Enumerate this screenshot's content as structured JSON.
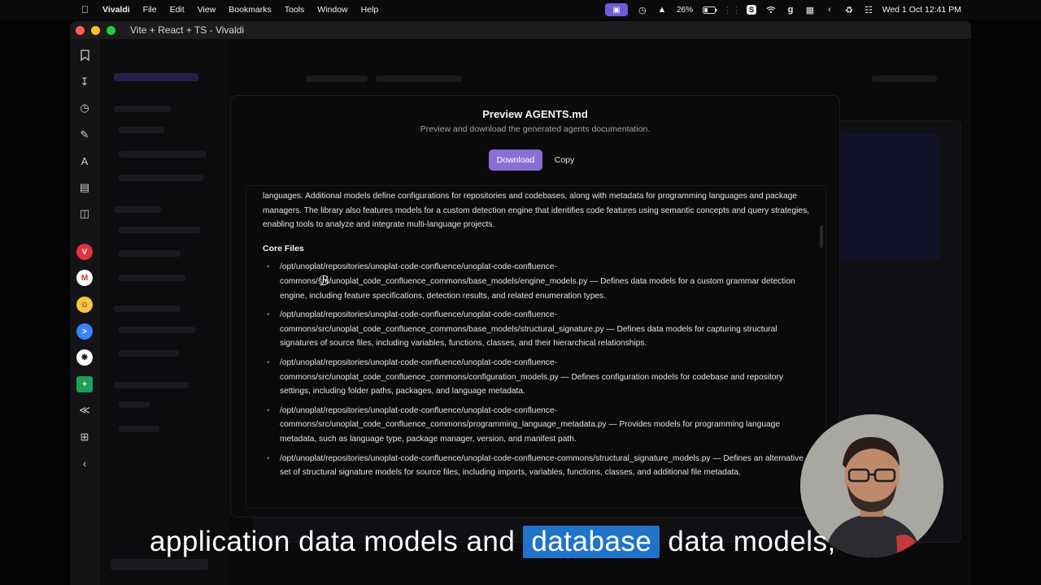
{
  "menubar": {
    "app": "Vivaldi",
    "menus": [
      "File",
      "Edit",
      "View",
      "Bookmarks",
      "Tools",
      "Window",
      "Help"
    ],
    "battery": "26%",
    "clock": "Wed 1 Oct  12:41 PM"
  },
  "window": {
    "title": "Vite + React + TS - Vivaldi"
  },
  "modal": {
    "title": "Preview AGENTS.md",
    "subtitle": "Preview and download the generated agents documentation.",
    "download_label": "Download",
    "copy_label": "Copy",
    "intro": "languages. Additional models define configurations for repositories and codebases, along with metadata for programming languages and package managers. The library also features models for a custom detection engine that identifies code features using semantic concepts and query strategies, enabling tools to analyze and integrate multi-language projects.",
    "section_heading": "Core Files",
    "files": [
      "/opt/unoplat/repositories/unoplat-code-confluence/unoplat-code-confluence-commons/src/unoplat_code_confluence_commons/base_models/engine_models.py — Defines data models for a custom grammar detection engine, including feature specifications, detection results, and related enumeration types.",
      "/opt/unoplat/repositories/unoplat-code-confluence/unoplat-code-confluence-commons/src/unoplat_code_confluence_commons/base_models/structural_signature.py — Defines data models for capturing structural signatures of source files, including variables, functions, classes, and their hierarchical relationships.",
      "/opt/unoplat/repositories/unoplat-code-confluence/unoplat-code-confluence-commons/src/unoplat_code_confluence_commons/configuration_models.py — Defines configuration models for codebase and repository settings, including folder paths, packages, and language metadata.",
      "/opt/unoplat/repositories/unoplat-code-confluence/unoplat-code-confluence-commons/src/unoplat_code_confluence_commons/programming_language_metadata.py — Provides models for programming language metadata, such as language type, package manager, version, and manifest path.",
      "/opt/unoplat/repositories/unoplat-code-confluence/unoplat-code-confluence-commons/structural_signature_models.py — Defines an alternative set of structural signature models for source files, including imports, variables, functions, classes, and additional file metadata."
    ]
  },
  "caption": {
    "before": "application data models and",
    "highlight": "database",
    "after": "data models,"
  }
}
